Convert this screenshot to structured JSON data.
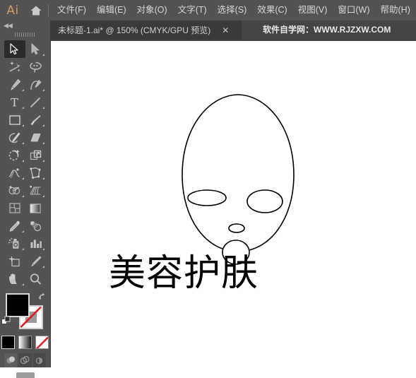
{
  "app": {
    "logo_text": "Ai",
    "home_icon": "home-icon"
  },
  "menubar": {
    "items": [
      {
        "label": "文件(F)",
        "name": "menu-file"
      },
      {
        "label": "编辑(E)",
        "name": "menu-edit"
      },
      {
        "label": "对象(O)",
        "name": "menu-object"
      },
      {
        "label": "文字(T)",
        "name": "menu-type"
      },
      {
        "label": "选择(S)",
        "name": "menu-select"
      },
      {
        "label": "效果(C)",
        "name": "menu-effect"
      },
      {
        "label": "视图(V)",
        "name": "menu-view"
      },
      {
        "label": "窗口(W)",
        "name": "menu-window"
      },
      {
        "label": "帮助(H)",
        "name": "menu-help"
      }
    ]
  },
  "tabbar": {
    "document_tab": {
      "title": "未标题-1.ai* @ 150% (CMYK/GPU 预览)",
      "close_label": "✕"
    },
    "watermark": "软件自学网：WWW.RJZXW.COM"
  },
  "toolbar": {
    "collapse_label": "◀◀",
    "tools": [
      {
        "label": "选择工具",
        "name": "tool-selection",
        "selected": true,
        "has_flyout": false
      },
      {
        "label": "直接选择工具",
        "name": "tool-direct-selection",
        "selected": false,
        "has_flyout": true
      },
      {
        "label": "魔棒工具",
        "name": "tool-magic-wand",
        "selected": false,
        "has_flyout": false
      },
      {
        "label": "套索工具",
        "name": "tool-lasso",
        "selected": false,
        "has_flyout": false
      },
      {
        "label": "钢笔工具",
        "name": "tool-pen",
        "selected": false,
        "has_flyout": true
      },
      {
        "label": "曲率工具",
        "name": "tool-curvature",
        "selected": false,
        "has_flyout": false
      },
      {
        "label": "文字工具",
        "name": "tool-type",
        "selected": false,
        "has_flyout": true
      },
      {
        "label": "直线段工具",
        "name": "tool-line-segment",
        "selected": false,
        "has_flyout": true
      },
      {
        "label": "矩形工具",
        "name": "tool-rectangle",
        "selected": false,
        "has_flyout": true
      },
      {
        "label": "画笔工具",
        "name": "tool-paintbrush",
        "selected": false,
        "has_flyout": true
      },
      {
        "label": "Shaper 工具",
        "name": "tool-shaper",
        "selected": false,
        "has_flyout": true
      },
      {
        "label": "橡皮擦工具",
        "name": "tool-eraser",
        "selected": false,
        "has_flyout": true
      },
      {
        "label": "旋转工具",
        "name": "tool-rotate",
        "selected": false,
        "has_flyout": true
      },
      {
        "label": "比例缩放工具",
        "name": "tool-scale",
        "selected": false,
        "has_flyout": true
      },
      {
        "label": "宽度工具",
        "name": "tool-width",
        "selected": false,
        "has_flyout": true
      },
      {
        "label": "自由变换工具",
        "name": "tool-free-transform",
        "selected": false,
        "has_flyout": false
      },
      {
        "label": "形状生成器工具",
        "name": "tool-shape-builder",
        "selected": false,
        "has_flyout": true
      },
      {
        "label": "透视网格工具",
        "name": "tool-perspective-grid",
        "selected": false,
        "has_flyout": true
      },
      {
        "label": "网格工具",
        "name": "tool-mesh",
        "selected": false,
        "has_flyout": false
      },
      {
        "label": "渐变工具",
        "name": "tool-gradient",
        "selected": false,
        "has_flyout": false
      },
      {
        "label": "吸管工具",
        "name": "tool-eyedropper",
        "selected": false,
        "has_flyout": true
      },
      {
        "label": "混合工具",
        "name": "tool-blend",
        "selected": false,
        "has_flyout": false
      },
      {
        "label": "符号喷枪工具",
        "name": "tool-symbol-sprayer",
        "selected": false,
        "has_flyout": true
      },
      {
        "label": "柱形图工具",
        "name": "tool-column-graph",
        "selected": false,
        "has_flyout": true
      },
      {
        "label": "画板工具",
        "name": "tool-artboard",
        "selected": false,
        "has_flyout": false
      },
      {
        "label": "切片工具",
        "name": "tool-slice",
        "selected": false,
        "has_flyout": true
      },
      {
        "label": "抓手工具",
        "name": "tool-hand",
        "selected": false,
        "has_flyout": true
      },
      {
        "label": "缩放工具",
        "name": "tool-zoom",
        "selected": false,
        "has_flyout": false
      }
    ],
    "colors": {
      "fill": "#000000",
      "stroke": "#ffffff",
      "stroke_is_none": true,
      "fill_label": "填色",
      "stroke_label": "描边",
      "swap_label": "互换填色和描边",
      "default_label": "默认填色和描边"
    },
    "fill_modes": [
      {
        "label": "颜色",
        "name": "fillmode-color",
        "active": true
      },
      {
        "label": "渐变",
        "name": "fillmode-gradient",
        "active": false
      },
      {
        "label": "无",
        "name": "fillmode-none",
        "active": false
      }
    ],
    "draw_modes": [
      {
        "label": "正常绘图",
        "name": "drawmode-normal",
        "active": true
      },
      {
        "label": "背面绘图",
        "name": "drawmode-behind",
        "active": false
      },
      {
        "label": "内部绘图",
        "name": "drawmode-inside",
        "active": false
      }
    ],
    "screen_mode_label": "更改屏幕模式"
  },
  "canvas": {
    "artwork_name": "面膜脸部插图",
    "caption": "美容护肤",
    "stroke_color": "#000000",
    "fill_color": "#ffffff",
    "background": "#ffffff"
  }
}
